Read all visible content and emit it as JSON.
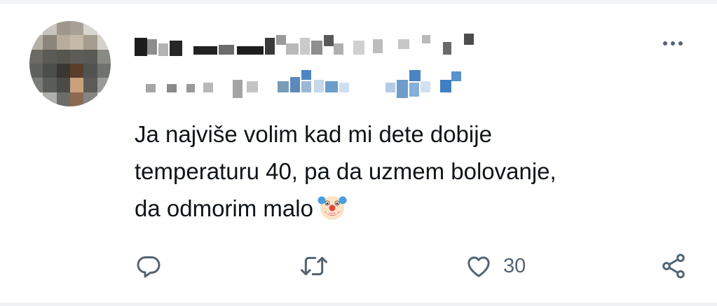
{
  "tweet": {
    "author": {
      "avatar_icon": "pixelated-avatar",
      "name_blurred": true,
      "handle_blurred": true
    },
    "menu_icon": "more-icon",
    "text_lines": [
      "Ja najviše volim kad mi dete dobije",
      "temperaturu 40, pa da uzmem bolovanje,",
      "da odmorim malo"
    ],
    "emoji": "clown-face-icon",
    "actions": {
      "reply_icon": "reply-icon",
      "retweet_icon": "retweet-icon",
      "like_icon": "heart-icon",
      "like_count": "30",
      "share_icon": "share-icon"
    }
  },
  "colors": {
    "text": "#0f1419",
    "secondary": "#536471",
    "background": "#ffffff"
  }
}
